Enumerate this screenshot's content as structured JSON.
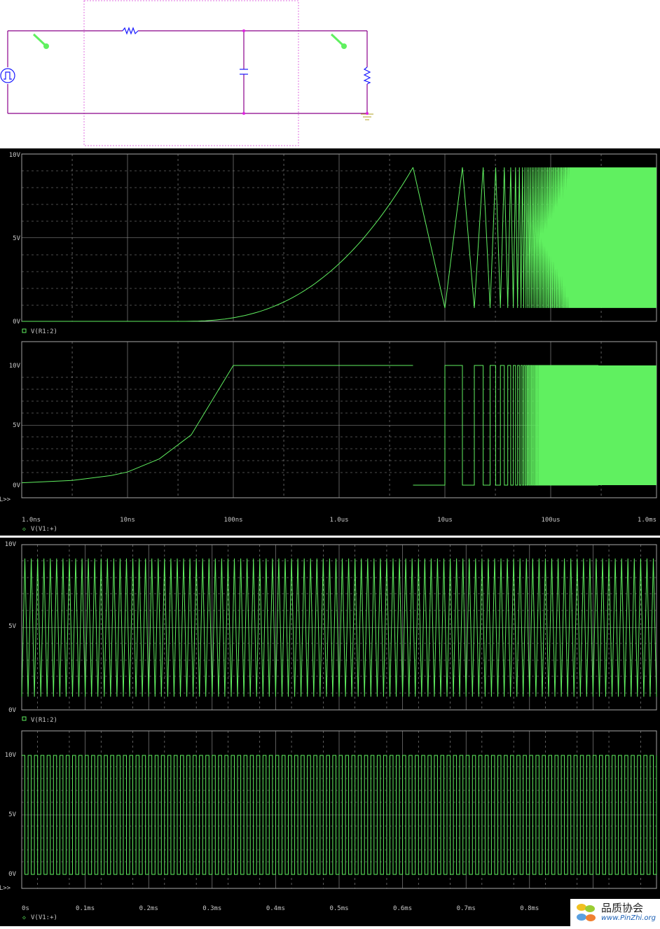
{
  "colors": {
    "trace": "#60f060",
    "wire": "#8b008b",
    "bg": "#000000",
    "grid": "#9a9a9a",
    "text": "#c8c8c8"
  },
  "schematic": {
    "components": [
      "pulse-source",
      "resistor",
      "capacitor",
      "load-resistor",
      "ground"
    ]
  },
  "panel1": {
    "x_ticks": [
      "1.0ns",
      "10ns",
      "100ns",
      "1.0us",
      "10us",
      "100us",
      "1.0ms"
    ],
    "plots": [
      {
        "y_ticks": [
          "10V",
          "5V",
          "0V"
        ],
        "trace": "V(R1:2)"
      },
      {
        "y_ticks": [
          "10V",
          "5V",
          "0V"
        ],
        "trace": "V(V1:+)"
      }
    ],
    "sel_marker": "SEL>>"
  },
  "panel2": {
    "x_ticks": [
      "0s",
      "0.1ms",
      "0.2ms",
      "0.3ms",
      "0.4ms",
      "0.5ms",
      "0.6ms",
      "0.7ms",
      "0.8ms"
    ],
    "plots": [
      {
        "y_ticks": [
          "10V",
          "5V",
          "0V"
        ],
        "trace": "V(R1:2)"
      },
      {
        "y_ticks": [
          "10V",
          "5V",
          "0V"
        ],
        "trace": "V(V1:+)"
      }
    ],
    "sel_marker": "SEL>>"
  },
  "chart_data": [
    {
      "type": "line",
      "x_scale": "log",
      "xlim": [
        "1.0ns",
        "1.0ms"
      ],
      "ylim": [
        0,
        10
      ],
      "series": [
        {
          "name": "V(R1:2)",
          "x": [
            "1.0ns",
            "30ns",
            "100ns",
            "300ns",
            "1.0us",
            "3us",
            "5us",
            "10us",
            "15us",
            "20us",
            "30us",
            "100us",
            "300us",
            "1.0ms"
          ],
          "y": [
            0,
            0,
            0.2,
            1.2,
            3.8,
            8.5,
            9.2,
            0.8,
            9.2,
            0.9,
            0.8,
            0.8,
            0.8,
            0.8
          ]
        }
      ]
    },
    {
      "type": "line",
      "x_scale": "log",
      "xlim": [
        "1.0ns",
        "1.0ms"
      ],
      "ylim": [
        0,
        10
      ],
      "series": [
        {
          "name": "V(V1:+)",
          "x": [
            "1.0ns",
            "3ns",
            "7ns",
            "10ns",
            "20ns",
            "40ns",
            "100ns",
            "5us",
            "1.0ms"
          ],
          "y": [
            0.2,
            0.4,
            0.8,
            1.1,
            2.2,
            4.2,
            10,
            10,
            "0-10 square"
          ]
        }
      ]
    },
    {
      "type": "line",
      "xlim": [
        "0s",
        "1.0ms"
      ],
      "ylim": [
        0,
        10
      ],
      "series": [
        {
          "name": "V(R1:2)",
          "y_range": [
            0.8,
            9.2
          ]
        }
      ]
    },
    {
      "type": "line",
      "xlim": [
        "0s",
        "1.0ms"
      ],
      "ylim": [
        0,
        10
      ],
      "series": [
        {
          "name": "V(V1:+)",
          "y_range": [
            0,
            10
          ]
        }
      ]
    }
  ],
  "watermark": {
    "title": "品质协会",
    "url": "www.PinZhi.org"
  }
}
